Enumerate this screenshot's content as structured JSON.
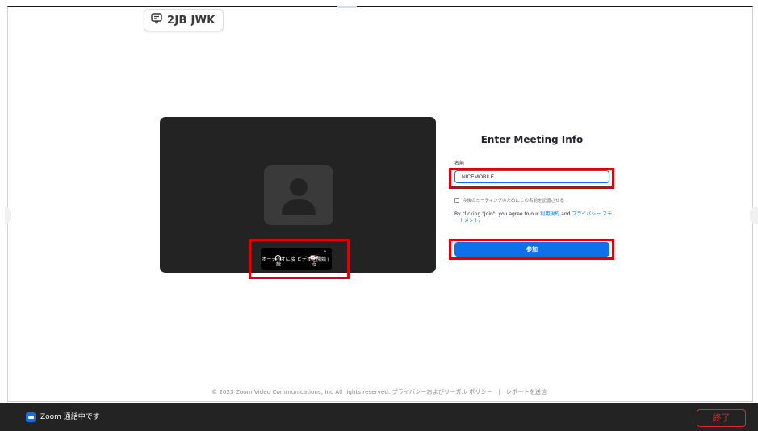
{
  "meeting": {
    "id_label": "2JB JWK"
  },
  "preview": {
    "audio_label": "オーディオに接続",
    "video_label": "ビデオを開始する"
  },
  "form": {
    "title": "Enter Meeting Info",
    "name_label": "名前",
    "name_value": "NICEMOBILE",
    "remember_label": "今後のミーティングのためにこの名前を記憶させる",
    "terms_prefix": "By clicking \"Join\", you agree to our ",
    "terms_link": "利用規約",
    "terms_and": " and ",
    "privacy_link": "プライバシー ステートメント",
    "terms_suffix": "。",
    "join_label": "参加"
  },
  "footer": {
    "copyright": "© 2023 Zoom Video Communications, Inc All rights reserved.",
    "privacy_policy": "プライバシーおよびリーガル ポリシー",
    "separator": "|",
    "report": "レポートを送信"
  },
  "bottom_bar": {
    "status": "Zoom 通話中です",
    "end_label": "終了"
  },
  "colors": {
    "accent": "#0e71eb",
    "highlight": "#e0000b",
    "end": "#e02828"
  }
}
